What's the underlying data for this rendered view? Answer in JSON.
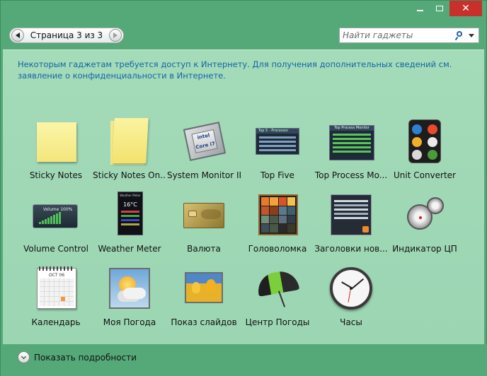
{
  "window": {
    "controls": {
      "minimize": "minimize",
      "maximize": "maximize",
      "close": "✕"
    }
  },
  "pager": {
    "label": "Страница 3 из 3"
  },
  "search": {
    "placeholder": "Найти гаджеты"
  },
  "notice": {
    "text": "Некоторым гаджетам требуется доступ к Интернету. Для получения дополнительных сведений см. заявление о конфиденциальности в Интернете."
  },
  "gadgets": [
    {
      "label": "Sticky Notes",
      "icon": "sticky-note-icon"
    },
    {
      "label": "Sticky Notes On...",
      "icon": "sticky-note-stack-icon"
    },
    {
      "label": "System Monitor II",
      "icon": "cpu-chip-icon"
    },
    {
      "label": "Top Five",
      "icon": "top-five-icon",
      "tile_title": "Top 5 - Processor"
    },
    {
      "label": "Top Process Mo...",
      "icon": "top-process-monitor-icon",
      "tile_title": "Top Process Monitor"
    },
    {
      "label": "Unit Converter",
      "icon": "unit-converter-icon"
    },
    {
      "label": "Volume Control",
      "icon": "volume-control-icon",
      "tile_title": "Volume 100%"
    },
    {
      "label": "Weather Meter",
      "icon": "weather-meter-icon",
      "tile_title": "Weather Meter",
      "tile_temp": "16°C"
    },
    {
      "label": "Валюта",
      "icon": "currency-card-icon"
    },
    {
      "label": "Головоломка",
      "icon": "puzzle-icon"
    },
    {
      "label": "Заголовки нов...",
      "icon": "rss-headlines-icon"
    },
    {
      "label": "Индикатор ЦП",
      "icon": "cpu-meter-icon"
    },
    {
      "label": "Календарь",
      "icon": "calendar-icon",
      "tile_month": "OCT 06"
    },
    {
      "label": "Моя Погода",
      "icon": "my-weather-icon"
    },
    {
      "label": "Показ слайдов",
      "icon": "slideshow-icon"
    },
    {
      "label": "Центр Погоды",
      "icon": "weather-center-umbrella-icon"
    },
    {
      "label": "Часы",
      "icon": "clock-icon"
    }
  ],
  "details": {
    "label": "Показать подробности"
  },
  "colors": {
    "window_frame": "#55a978",
    "panel": "#a4dbb9",
    "link": "#1465a8",
    "close": "#c7302b"
  }
}
